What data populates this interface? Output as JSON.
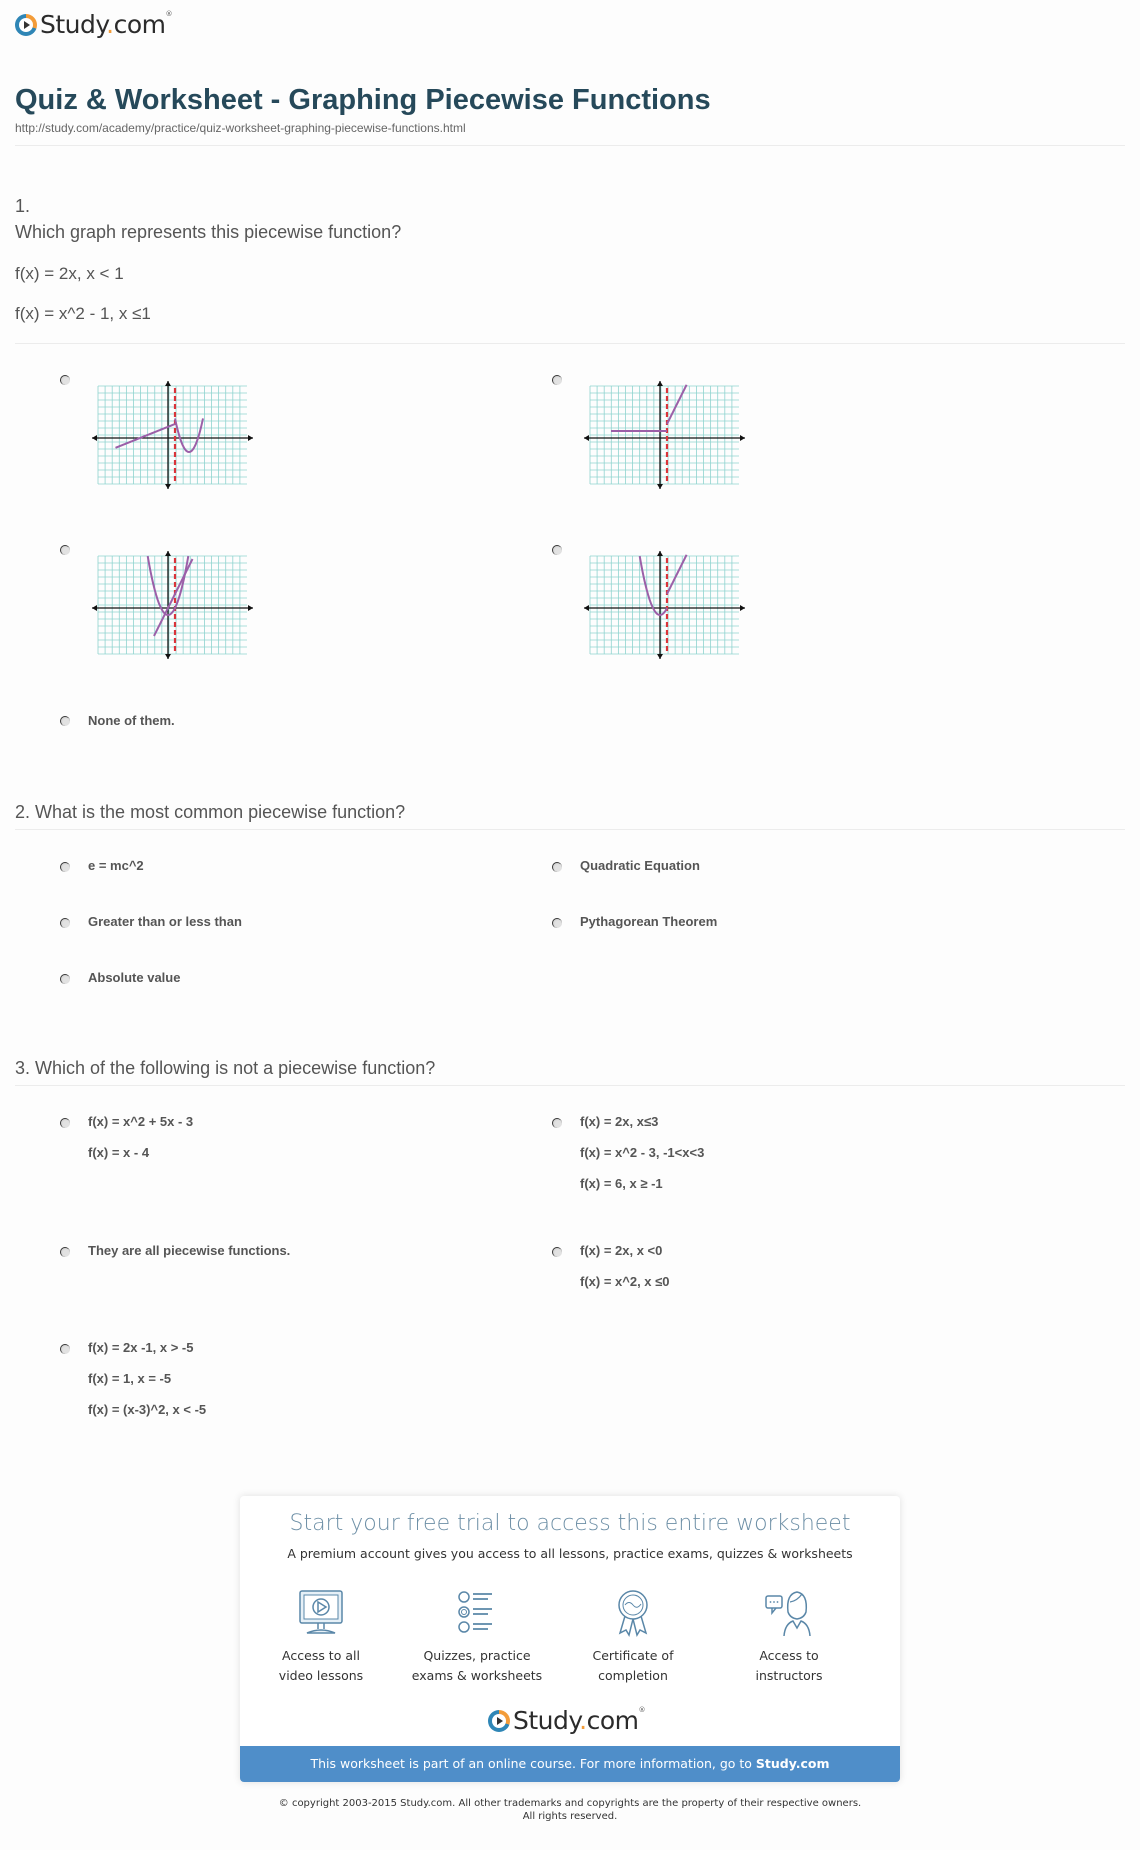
{
  "header": {
    "logo_text": "Study",
    "logo_dot": ".",
    "logo_tld": "com",
    "title": "Quiz & Worksheet - Graphing Piecewise Functions",
    "url": "http://study.com/academy/practice/quiz-worksheet-graphing-piecewise-functions.html"
  },
  "questions": [
    {
      "number": "1.",
      "text": "Which graph represents this piecewise function?",
      "equations": [
        "f(x) = 2x, x < 1",
        "f(x) = x^2 - 1, x ≤1"
      ],
      "graph_options": [
        {
          "description": "line rising to y=2 at x=1 then dip/parabola crossing to the right"
        },
        {
          "description": "horizontal line y=1 for x<1, line rising from (1,2)"
        },
        {
          "description": "two curves through origin: line 2x and parabola"
        },
        {
          "description": "parabola x^2-1 for x<1, line rising from (1,2)"
        }
      ],
      "text_options": [
        "None of them."
      ]
    },
    {
      "number": "2.",
      "text": "What is the most common piecewise function?",
      "options": [
        "e = mc^2",
        "Quadratic Equation",
        "Greater than or less than",
        "Pythagorean Theorem",
        "Absolute value"
      ]
    },
    {
      "number": "3.",
      "text": "Which of the following is not a piecewise function?",
      "options": [
        {
          "lines": [
            "f(x) = x^2 + 5x - 3",
            "f(x) = x - 4"
          ]
        },
        {
          "lines": [
            "f(x) = 2x, x≤3",
            "f(x) = x^2 - 3, -1<x<3",
            "f(x) = 6, x ≥ -1"
          ]
        },
        {
          "lines": [
            "They are all piecewise functions."
          ]
        },
        {
          "lines": [
            "f(x) = 2x, x <0",
            "f(x) = x^2, x ≤0"
          ]
        },
        {
          "lines": [
            "f(x) = 2x -1, x > -5",
            "f(x) = 1, x = -5",
            "f(x) = (x-3)^2, x < -5"
          ]
        }
      ]
    }
  ],
  "promo": {
    "title": "Start your free trial to access this entire worksheet",
    "subtitle": "A premium account gives you access to all lessons, practice exams, quizzes & worksheets",
    "features": [
      {
        "icon": "video-lesson-icon",
        "line1": "Access to all",
        "line2": "video lessons"
      },
      {
        "icon": "quiz-list-icon",
        "line1": "Quizzes, practice",
        "line2": "exams & worksheets"
      },
      {
        "icon": "certificate-icon",
        "line1": "Certificate of",
        "line2": "completion"
      },
      {
        "icon": "instructor-icon",
        "line1": "Access to",
        "line2": "instructors"
      }
    ],
    "bar_text": "This worksheet is part of an online course. For more information, go to ",
    "bar_link": "Study.com"
  },
  "footer": {
    "copyright_line1": "© copyright 2003-2015 Study.com. All other trademarks and copyrights are the property of their respective owners.",
    "copyright_line2": "All rights reserved."
  },
  "colors": {
    "title": "#26495a",
    "grid": "#8fd3cf",
    "curve": "#9b5fa8",
    "dashed_line": "#d9343a",
    "promo_bar": "#4f8ec9",
    "brand_orange": "#f39c39",
    "brand_blue": "#2f86b6"
  }
}
